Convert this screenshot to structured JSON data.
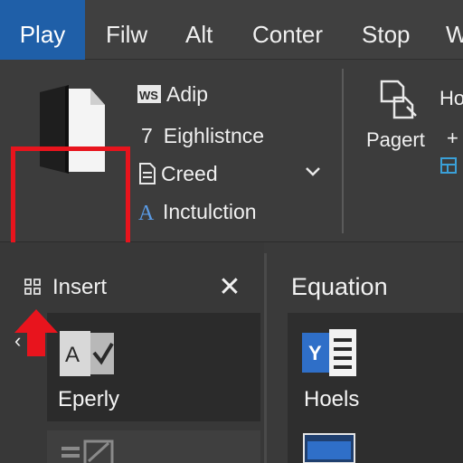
{
  "menu": {
    "items": [
      "Play",
      "Filw",
      "Alt",
      "Conter",
      "Stop",
      "W"
    ],
    "active_index": 0
  },
  "ribbon": {
    "rows": [
      {
        "icon": "ws-word-icon",
        "label": "Adip"
      },
      {
        "icon": "number-seven",
        "prefix": "7",
        "label": "Eighlistnce"
      },
      {
        "icon": "document-icon",
        "label": "Creed"
      },
      {
        "icon": "letter-a-icon",
        "label": "Inctulction"
      }
    ],
    "page_group_label": "Pagert",
    "right_fragment_1": "Ho",
    "right_fragment_2": "+"
  },
  "left_panel": {
    "title": "Insert",
    "card_label": "Eperly",
    "card_icon_letter": "A"
  },
  "right_panel": {
    "title": "Equation",
    "card_label": "Hoels",
    "card_icon_letter": "Y"
  },
  "colors": {
    "accent": "#1f5fa8",
    "highlight": "#e8141d",
    "word_blue": "#2f6fc8"
  }
}
